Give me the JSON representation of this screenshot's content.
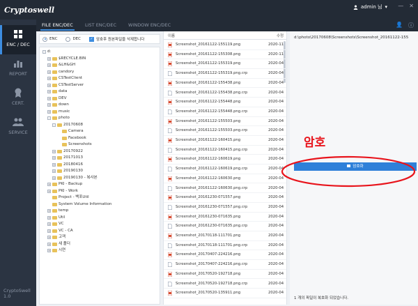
{
  "app": {
    "logo": "Cryptoswell",
    "user": "admin 님",
    "version": "CryptoSwell 1.0"
  },
  "nav": [
    {
      "label": "ENC / DEC",
      "icon": "lock-grid-icon",
      "active": true
    },
    {
      "label": "REPORT",
      "icon": "report-chart-icon",
      "active": false
    },
    {
      "label": "CERT.",
      "icon": "certificate-icon",
      "active": false
    },
    {
      "label": "SERVICE",
      "icon": "people-service-icon",
      "active": false
    }
  ],
  "tabs": [
    {
      "label": "FILE ENC/DEC",
      "active": true
    },
    {
      "label": "LIST ENC/DEC",
      "active": false
    },
    {
      "label": "WINDOW ENC/DEC",
      "active": false
    }
  ],
  "options": {
    "enc": "ENC",
    "dec": "DEC",
    "delete_original": "암호후 원본파일을 삭제합니다"
  },
  "tree": [
    {
      "label": "d:",
      "depth": 0,
      "exp": "-"
    },
    {
      "label": "$RECYCLE.BIN",
      "depth": 1,
      "exp": "+"
    },
    {
      "label": "&LH&GH",
      "depth": 1,
      "exp": "+"
    },
    {
      "label": "candory",
      "depth": 1,
      "exp": "+"
    },
    {
      "label": "CSTestClient",
      "depth": 1,
      "exp": "+"
    },
    {
      "label": "CSTestServer",
      "depth": 1,
      "exp": "+"
    },
    {
      "label": "data",
      "depth": 1,
      "exp": "+"
    },
    {
      "label": "DEV",
      "depth": 1,
      "exp": "+"
    },
    {
      "label": "down",
      "depth": 1,
      "exp": "+"
    },
    {
      "label": "music",
      "depth": 1,
      "exp": "+"
    },
    {
      "label": "photo",
      "depth": 1,
      "exp": "-"
    },
    {
      "label": "20170608",
      "depth": 2,
      "exp": "-"
    },
    {
      "label": "Camera",
      "depth": 3,
      "exp": ""
    },
    {
      "label": "Facebook",
      "depth": 3,
      "exp": ""
    },
    {
      "label": "Screenshots",
      "depth": 3,
      "exp": ""
    },
    {
      "label": "20170922",
      "depth": 2,
      "exp": "+"
    },
    {
      "label": "20171013",
      "depth": 2,
      "exp": "+"
    },
    {
      "label": "20180416",
      "depth": 2,
      "exp": "+"
    },
    {
      "label": "20190130",
      "depth": 2,
      "exp": "+"
    },
    {
      "label": "20190130 - 복사본",
      "depth": 2,
      "exp": "+"
    },
    {
      "label": "PKI - Backup",
      "depth": 1,
      "exp": "+"
    },
    {
      "label": "PKI - Work",
      "depth": 1,
      "exp": "+"
    },
    {
      "label": "Project - 백포Util",
      "depth": 1,
      "exp": ""
    },
    {
      "label": "System Volume Information",
      "depth": 1,
      "exp": ""
    },
    {
      "label": "temp",
      "depth": 1,
      "exp": "+"
    },
    {
      "label": "Util",
      "depth": 1,
      "exp": "+"
    },
    {
      "label": "VC",
      "depth": 1,
      "exp": "+"
    },
    {
      "label": "VC - CA",
      "depth": 1,
      "exp": "+"
    },
    {
      "label": "고객",
      "depth": 1,
      "exp": "+"
    },
    {
      "label": "새 폴더",
      "depth": 1,
      "exp": "+"
    },
    {
      "label": "시연",
      "depth": 1,
      "exp": "+"
    }
  ],
  "filelist": {
    "col_name": "이름",
    "col_date": "수정",
    "rows": [
      {
        "name": "Screenshot_20161122-155119.png",
        "date": "2020-11",
        "type": "png"
      },
      {
        "name": "Screenshot_20161122-155308.png",
        "date": "2020-11",
        "type": "png"
      },
      {
        "name": "Screenshot_20161122-155319.png",
        "date": "2020-04",
        "type": "png"
      },
      {
        "name": "Screenshot_20161122-155319.png.crp",
        "date": "2020-04",
        "type": "crp"
      },
      {
        "name": "Screenshot_20161122-155438.png",
        "date": "2020-04",
        "type": "png"
      },
      {
        "name": "Screenshot_20161122-155438.png.crp",
        "date": "2020-04",
        "type": "crp"
      },
      {
        "name": "Screenshot_20161122-155448.png",
        "date": "2020-04",
        "type": "png"
      },
      {
        "name": "Screenshot_20161122-155448.png.crp",
        "date": "2020-04",
        "type": "crp"
      },
      {
        "name": "Screenshot_20161122-155503.png",
        "date": "2020-04",
        "type": "png"
      },
      {
        "name": "Screenshot_20161122-155503.png.crp",
        "date": "2020-04",
        "type": "crp"
      },
      {
        "name": "Screenshot_20161122-160415.png",
        "date": "2020-04",
        "type": "png"
      },
      {
        "name": "Screenshot_20161122-160415.png.crp",
        "date": "2020-04",
        "type": "crp"
      },
      {
        "name": "Screenshot_20161122-160619.png",
        "date": "2020-04",
        "type": "png"
      },
      {
        "name": "Screenshot_20161122-160619.png.crp",
        "date": "2020-04",
        "type": "crp"
      },
      {
        "name": "Screenshot_20161122-160630.png",
        "date": "2020-04",
        "type": "png"
      },
      {
        "name": "Screenshot_20161122-160630.png.crp",
        "date": "2020-04",
        "type": "crp"
      },
      {
        "name": "Screenshot_20161230-071557.png",
        "date": "2020-04",
        "type": "png"
      },
      {
        "name": "Screenshot_20161230-071557.png.crp",
        "date": "2020-04",
        "type": "crp"
      },
      {
        "name": "Screenshot_20161230-071635.png",
        "date": "2020-04",
        "type": "png"
      },
      {
        "name": "Screenshot_20161230-071635.png.crp",
        "date": "2020-04",
        "type": "crp"
      },
      {
        "name": "Screenshot_20170118-111701.png",
        "date": "2020-04",
        "type": "png"
      },
      {
        "name": "Screenshot_20170118-111701.png.crp",
        "date": "2020-04",
        "type": "crp"
      },
      {
        "name": "Screenshot_20170407-224216.png",
        "date": "2020-04",
        "type": "png"
      },
      {
        "name": "Screenshot_20170407-224216.png.crp",
        "date": "2020-04",
        "type": "crp"
      },
      {
        "name": "Screenshot_20170520-192718.png",
        "date": "2020-04",
        "type": "png"
      },
      {
        "name": "Screenshot_20170520-192718.png.crp",
        "date": "2020-04",
        "type": "crp"
      },
      {
        "name": "Screenshot_20170520-135911.png",
        "date": "2020-04",
        "type": "png"
      }
    ]
  },
  "right": {
    "path": "d:\\photo\\20170608\\Screenshots\\Screenshot_20161122-155",
    "encrypt_button": "암호화",
    "status": "1 개의 파일이 복호화 되었습니다."
  },
  "annotation": {
    "text": "암호",
    "color": "#e8141c"
  },
  "colors": {
    "accent": "#2f80d9",
    "sidebar": "#2b3442",
    "titlebar": "#232b36",
    "folder": "#e8c25a"
  }
}
